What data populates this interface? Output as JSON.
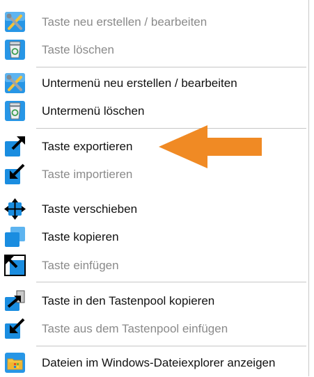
{
  "menu": {
    "items": [
      {
        "label": "Taste neu erstellen / bearbeiten",
        "icon": "tools-edit-icon",
        "enabled": false
      },
      {
        "label": "Taste löschen",
        "icon": "recycle-bin-icon",
        "enabled": false
      },
      {
        "label": "Untermenü neu erstellen / bearbeiten",
        "icon": "tools-edit-icon",
        "enabled": true
      },
      {
        "label": "Untermenü löschen",
        "icon": "recycle-bin-icon",
        "enabled": true
      },
      {
        "label": "Taste exportieren",
        "icon": "export-arrow-icon",
        "enabled": true
      },
      {
        "label": "Taste importieren",
        "icon": "import-arrow-icon",
        "enabled": false
      },
      {
        "label": "Taste verschieben",
        "icon": "move-arrows-icon",
        "enabled": true
      },
      {
        "label": "Taste kopieren",
        "icon": "copy-squares-icon",
        "enabled": true
      },
      {
        "label": "Taste einfügen",
        "icon": "paste-arrow-icon",
        "enabled": false
      },
      {
        "label": "Taste in den Tastenpool kopieren",
        "icon": "copy-to-pool-icon",
        "enabled": true
      },
      {
        "label": "Taste aus dem Tastenpool einfügen",
        "icon": "paste-from-pool-icon",
        "enabled": false
      },
      {
        "label": "Dateien im Windows-Dateiexplorer anzeigen",
        "icon": "file-explorer-icon",
        "enabled": true
      }
    ]
  },
  "colors": {
    "accent_blue": "#1a8de0",
    "callout_arrow": "#f08a24",
    "disabled_text": "#8a8a8a",
    "separator": "#c6c6c6"
  }
}
